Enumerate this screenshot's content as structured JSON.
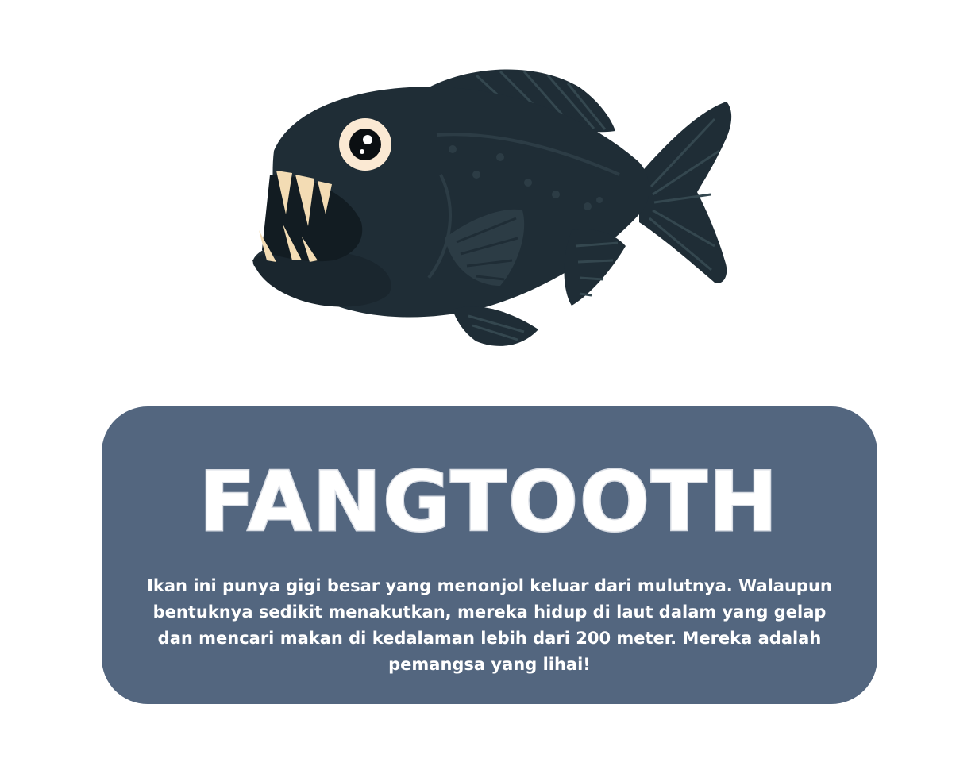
{
  "title": "FANGTOOTH",
  "description": "Ikan ini punya gigi besar yang menonjol keluar dari mulutnya. Walaupun bentuknya sedikit menakutkan, mereka hidup di laut dalam yang gelap dan mencari makan di kedalaman lebih dari 200 meter. Mereka adalah pemangsa yang lihai!",
  "colors": {
    "card_background": "#53667f",
    "fish_body": "#1f2d36",
    "fish_teeth": "#f3dcb4",
    "title_fill": "#ffffff",
    "title_outline": "#e6e9ee",
    "text": "#ffffff"
  },
  "illustration": {
    "subject": "fangtooth-fish"
  }
}
